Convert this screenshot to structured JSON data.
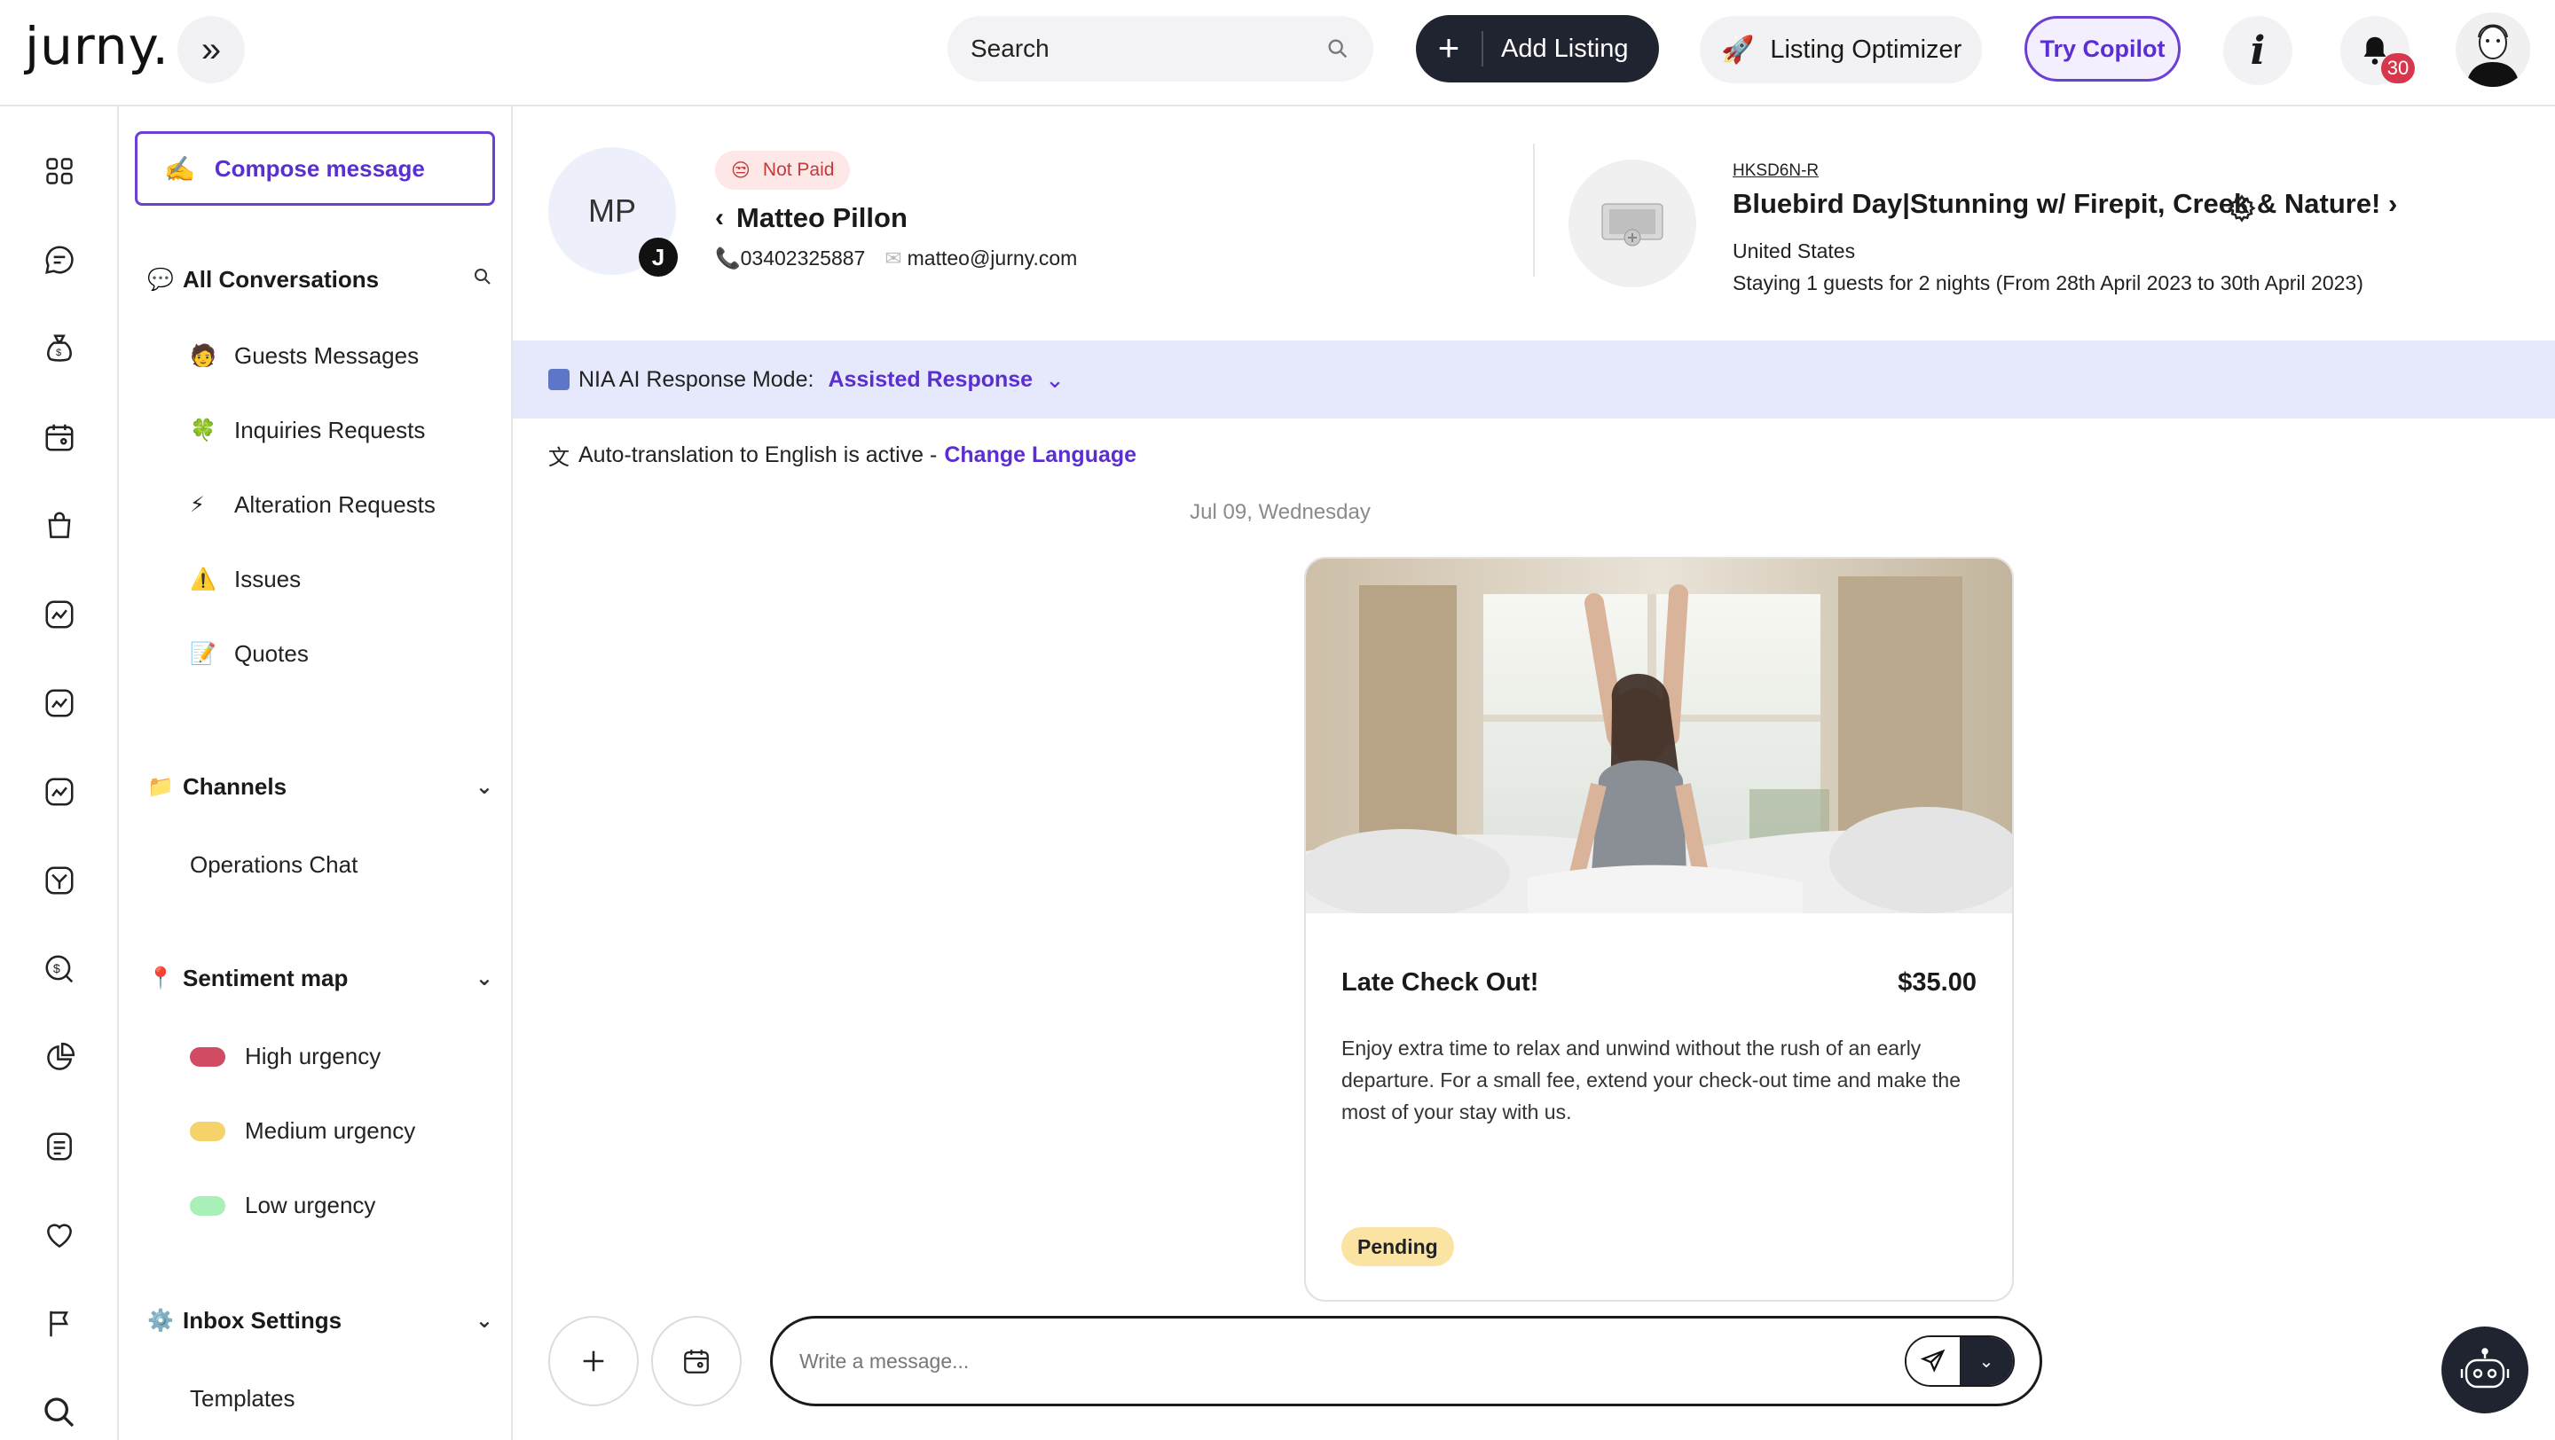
{
  "brand": {
    "logo_text": "jurny."
  },
  "topbar": {
    "search_placeholder": "Search",
    "add_listing_label": "Add Listing",
    "optimizer_label": "Listing Optimizer",
    "copilot_label": "Try Copilot",
    "info_label": "i",
    "notification_count": "30"
  },
  "rail": {
    "icons": [
      "dashboard-icon",
      "chat-icon",
      "money-bag-icon",
      "calendar-icon",
      "shopping-bag-icon",
      "analytics-icon",
      "analytics-icon-2",
      "analytics-icon-3",
      "tasks-icon",
      "dollar-icon",
      "pie-chart-icon",
      "notes-icon",
      "heart-icon",
      "flag-icon",
      "search-icon"
    ]
  },
  "sidebar": {
    "compose_label": "Compose message",
    "all_conversations": {
      "label": "All Conversations",
      "items": [
        {
          "icon": "🧑",
          "label": "Guests Messages"
        },
        {
          "icon": "🍀",
          "label": "Inquiries Requests"
        },
        {
          "icon": "⚡",
          "label": "Alteration Requests"
        },
        {
          "icon": "⚠️",
          "label": "Issues"
        },
        {
          "icon": "📝",
          "label": "Quotes"
        }
      ]
    },
    "channels": {
      "label": "Channels",
      "items": [
        "Operations Chat"
      ]
    },
    "sentiment": {
      "label": "Sentiment map",
      "items": [
        {
          "label": "High urgency",
          "color": "#d14b63"
        },
        {
          "label": "Medium urgency",
          "color": "#f5d36a"
        },
        {
          "label": "Low urgency",
          "color": "#a8f0b8"
        }
      ]
    },
    "inbox_settings": {
      "label": "Inbox Settings",
      "items": [
        "Templates"
      ]
    }
  },
  "guest": {
    "initials": "MP",
    "channel_badge": "J",
    "payment_status": "Not Paid",
    "name": "Matteo Pillon",
    "phone": "03402325887",
    "email": "matteo@jurny.com"
  },
  "listing": {
    "code": "HKSD6N-R",
    "title": "Bluebird Day|Stunning w/ Firepit, Creek & Nature!",
    "country": "United States",
    "stay": "Staying 1 guests for 2 nights (From 28th April 2023 to 30th April 2023)"
  },
  "ai_mode": {
    "label": "NIA AI Response Mode:",
    "value": "Assisted Response"
  },
  "translation": {
    "text": "Auto-translation to English is active -",
    "link": "Change Language"
  },
  "conversation": {
    "date": "Jul 09, Wednesday",
    "card": {
      "title": "Late Check Out!",
      "price": "$35.00",
      "description": "Enjoy extra time to relax and unwind without the rush of an early departure. For a small fee, extend your check-out time and make the most of your stay with us.",
      "status": "Pending"
    }
  },
  "composer": {
    "placeholder": "Write a message..."
  },
  "colors": {
    "accent": "#5a2ed0",
    "dark": "#1f2430",
    "ai_bar": "#e6e9fb"
  }
}
